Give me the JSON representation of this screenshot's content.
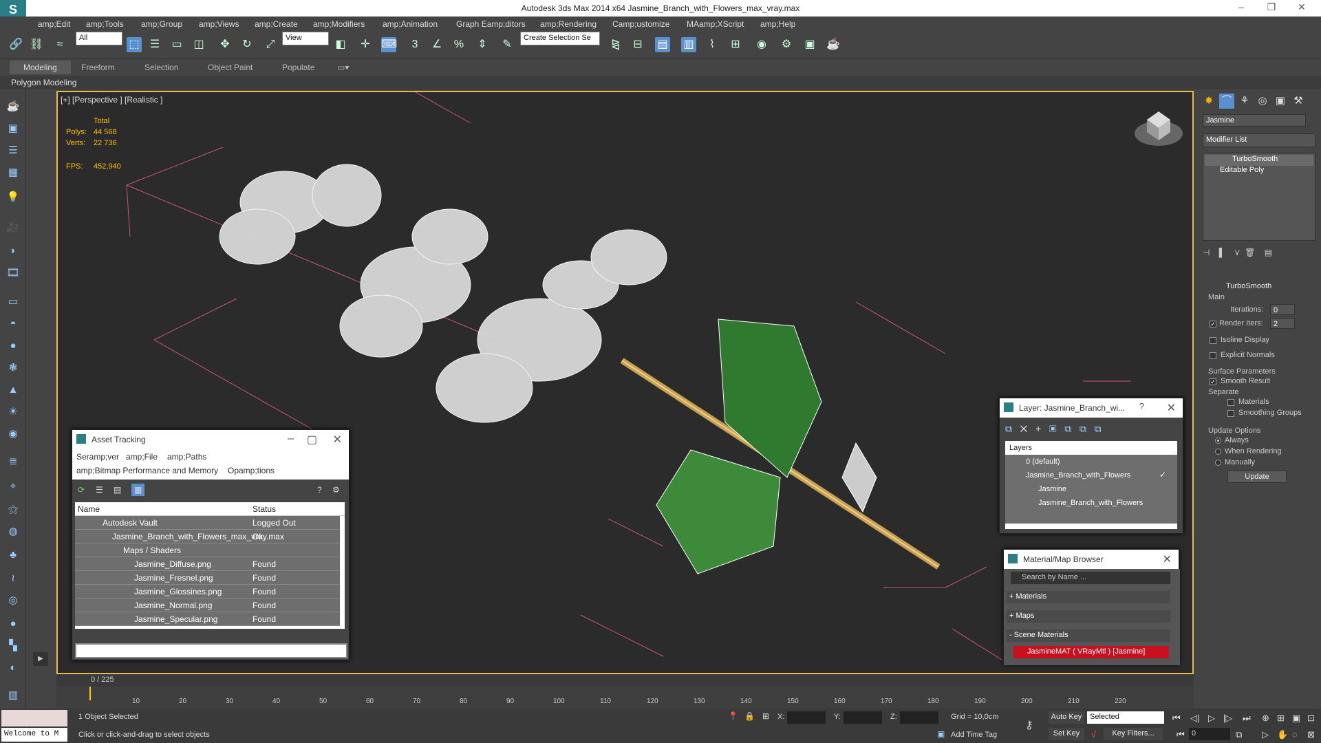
{
  "app": {
    "title": "Autodesk 3ds Max  2014 x64    Jasmine_Branch_with_Flowers_max_vray.max"
  },
  "menu": [
    "amp;Edit",
    "amp;Tools",
    "amp;Group",
    "amp;Views",
    "amp;Create",
    "amp;Modifiers",
    "amp;Animation",
    "Graph Eamp;ditors",
    "amp;Rendering",
    "Camp;ustomize",
    "MAamp;XScript",
    "amp;Help"
  ],
  "toolbar": {
    "selection_filter": "All",
    "ref_coord": "View",
    "named_selection": "Create Selection Se"
  },
  "ribbon": {
    "tabs": [
      "Modeling",
      "Freeform",
      "Selection",
      "Object Paint",
      "Populate"
    ],
    "sub": "Polygon Modeling"
  },
  "viewport": {
    "label": "[+] [Perspective ] [Realistic ]",
    "stats": {
      "total_label": "Total",
      "polys_label": "Polys:",
      "polys": "44 568",
      "verts_label": "Verts:",
      "verts": "22 736",
      "fps_label": "FPS:",
      "fps": "452,940"
    }
  },
  "command_panel": {
    "object_name": "Jasmine",
    "modifier_list": "Modifier List",
    "stack": [
      "TurboSmooth",
      "Editable Poly"
    ],
    "turbosmooth": {
      "title": "TurboSmooth",
      "main": "Main",
      "iterations_label": "Iterations:",
      "iterations": "0",
      "render_iters_label": "Render Iters:",
      "render_iters": "2",
      "isoline": "Isoline Display",
      "explicit": "Explicit Normals",
      "surface": "Surface Parameters",
      "smooth_result": "Smooth Result",
      "separate": "Separate",
      "materials": "Materials",
      "smoothing_groups": "Smoothing Groups",
      "update_options": "Update Options",
      "always": "Always",
      "when_rendering": "When Rendering",
      "manually": "Manually",
      "update": "Update"
    }
  },
  "asset_tracking": {
    "title": "Asset Tracking",
    "menu1": [
      "Seramp;ver",
      "amp;File",
      "amp;Paths"
    ],
    "menu2": [
      "amp;Bitmap Performance and Memory",
      "Opamp;tions"
    ],
    "columns": [
      "Name",
      "Status"
    ],
    "rows": [
      {
        "name": "Autodesk Vault",
        "status": "Logged Out"
      },
      {
        "name": "Jasmine_Branch_with_Flowers_max_vray.max",
        "status": "Ok"
      },
      {
        "name": "Maps / Shaders",
        "status": ""
      },
      {
        "name": "Jasmine_Diffuse.png",
        "status": "Found"
      },
      {
        "name": "Jasmine_Fresnel.png",
        "status": "Found"
      },
      {
        "name": "Jasmine_Glossines.png",
        "status": "Found"
      },
      {
        "name": "Jasmine_Normal.png",
        "status": "Found"
      },
      {
        "name": "Jasmine_Specular.png",
        "status": "Found"
      }
    ]
  },
  "layer_window": {
    "title": "Layer: Jasmine_Branch_wi...",
    "header": "Layers",
    "items": [
      "0 (default)",
      "Jasmine_Branch_with_Flowers",
      "Jasmine",
      "Jasmine_Branch_with_Flowers"
    ]
  },
  "material_browser": {
    "title": "Material/Map Browser",
    "search": "Search by Name ...",
    "groups": [
      "+ Materials",
      "+ Maps",
      "- Scene Materials"
    ],
    "item": "JasmineMAT  ( VRayMtl )  [Jasmine]"
  },
  "timeline": {
    "frame": "0 / 225",
    "ticks": [
      "10",
      "20",
      "30",
      "40",
      "50",
      "60",
      "70",
      "80",
      "90",
      "100",
      "110",
      "120",
      "130",
      "140",
      "150",
      "160",
      "170",
      "180",
      "190",
      "200",
      "210",
      "220"
    ]
  },
  "status": {
    "welcome": "Welcome to M",
    "selected": "1 Object Selected",
    "hint": "Click or click-and-drag to select objects",
    "x_label": "X:",
    "y_label": "Y:",
    "z_label": "Z:",
    "grid": "Grid = 10,0cm",
    "add_time_tag": "Add Time Tag",
    "auto_key": "Auto Key",
    "set_key": "Set Key",
    "selected_combo": "Selected",
    "key_filters": "Key Filters...",
    "frame_field": "0"
  }
}
